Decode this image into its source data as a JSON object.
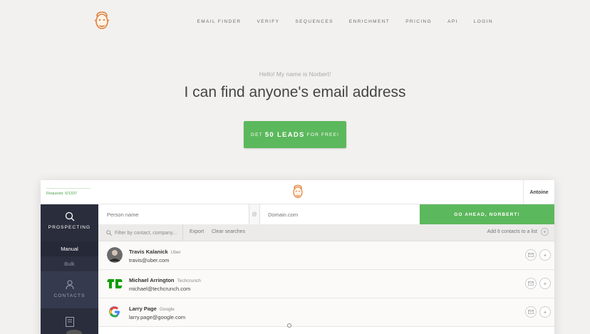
{
  "nav": {
    "logo": "norbert-logo",
    "links": [
      "EMAIL FINDER",
      "VERIFY",
      "SEQUENCES",
      "ENRICHMENT",
      "PRICING",
      "API",
      "LOGIN"
    ]
  },
  "hero": {
    "kicker": "Hello! My name is Norbert!",
    "headline": "I can find anyone's email address",
    "cta_pre": "GET",
    "cta_main": "50 LEADS",
    "cta_post": "FOR FREE!",
    "cta_color": "#5cb85c"
  },
  "app": {
    "requests": "Requests: 6/1337",
    "user": "Antoine",
    "sidebar": {
      "prospecting": "PROSPECTING",
      "manual": "Manual",
      "bulk": "Bulk",
      "contacts": "CONTACTS"
    },
    "search": {
      "person_placeholder": "Person name",
      "at": "@",
      "domain_placeholder": "Domain.com",
      "go": "GO AHEAD, NORBERT!"
    },
    "filter": {
      "placeholder": "Filter by contact, company...",
      "export": "Export",
      "clear": "Clear searches",
      "add_to_list": "Add 6 contacts to a list",
      "add_symbol": "+"
    },
    "contacts": [
      {
        "name": "Travis Kalanick",
        "company": "Uber",
        "email": "travis@uber.com"
      },
      {
        "name": "Michael Arrington",
        "company": "Techcrunch",
        "email": "michael@techcrunch.com"
      },
      {
        "name": "Larry Page",
        "company": "Google",
        "email": "larry.page@google.com"
      }
    ]
  }
}
